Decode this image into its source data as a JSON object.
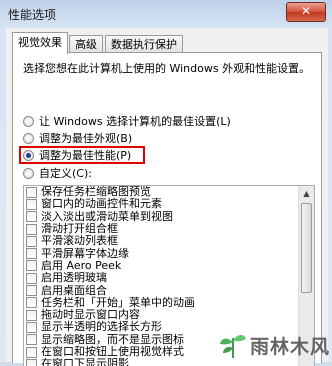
{
  "window": {
    "title": "性能选项",
    "close_glyph": "✕"
  },
  "tabs": [
    {
      "label": "视觉效果",
      "active": true
    },
    {
      "label": "高级",
      "active": false
    },
    {
      "label": "数据执行保护",
      "active": false
    }
  ],
  "description": "选择您想在此计算机上使用的 Windows 外观和性能设置。",
  "radios": [
    {
      "label": "让 Windows 选择计算机的最佳设置(L)",
      "checked": false
    },
    {
      "label": "调整为最佳外观(B)",
      "checked": false
    },
    {
      "label": "调整为最佳性能(P)",
      "checked": true
    },
    {
      "label": "自定义(C):",
      "checked": false
    }
  ],
  "effects": [
    "保存任务栏缩略图预览",
    "窗口内的动画控件和元素",
    "淡入淡出或滑动菜单到视图",
    "滑动打开组合框",
    "平滑滚动列表框",
    "平滑屏幕字体边缘",
    "启用 Aero Peek",
    "启用透明玻璃",
    "启用桌面组合",
    "任务栏和「开始」菜单中的动画",
    "拖动时显示窗口内容",
    "显示半透明的选择长方形",
    "显示缩略图，而不是显示图标",
    "在窗口和按钮上使用视觉样式",
    "在窗口下显示阴影",
    "在单击后淡出菜单"
  ],
  "watermark": {
    "text": "雨林木风",
    "icon": "leaf-logo-icon"
  }
}
